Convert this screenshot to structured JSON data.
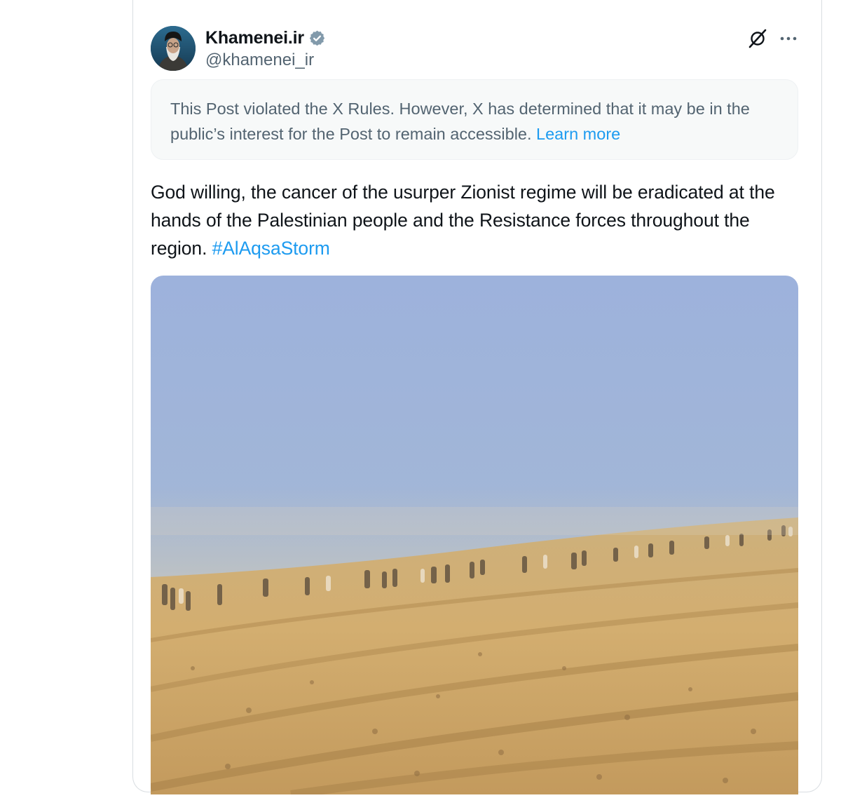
{
  "post": {
    "author": {
      "display_name": "Khamenei.ir",
      "handle": "@khamenei_ir",
      "verified_icon": "verified-badge-icon",
      "avatar_icon": "avatar"
    },
    "header_actions": {
      "grok_icon": "grok-icon",
      "more_icon": "more-options-icon"
    },
    "notice": {
      "text": "This Post violated the X Rules. However, X has determined that it may be in the public’s interest for the Post to remain accessible.",
      "link_label": "Learn more"
    },
    "body": {
      "text": "God willing, the cancer of the usurper Zionist regime will be eradicated at the hands of the Palestinian people and the Resistance forces throughout the region.",
      "hashtag": "#AlAqsaStorm"
    },
    "media": {
      "type": "video-thumbnail"
    }
  },
  "colors": {
    "text_primary": "#0f1419",
    "text_secondary": "#536471",
    "link": "#1d9bf0",
    "notice_bg": "#f7f9f9",
    "border": "#d9dde1"
  }
}
